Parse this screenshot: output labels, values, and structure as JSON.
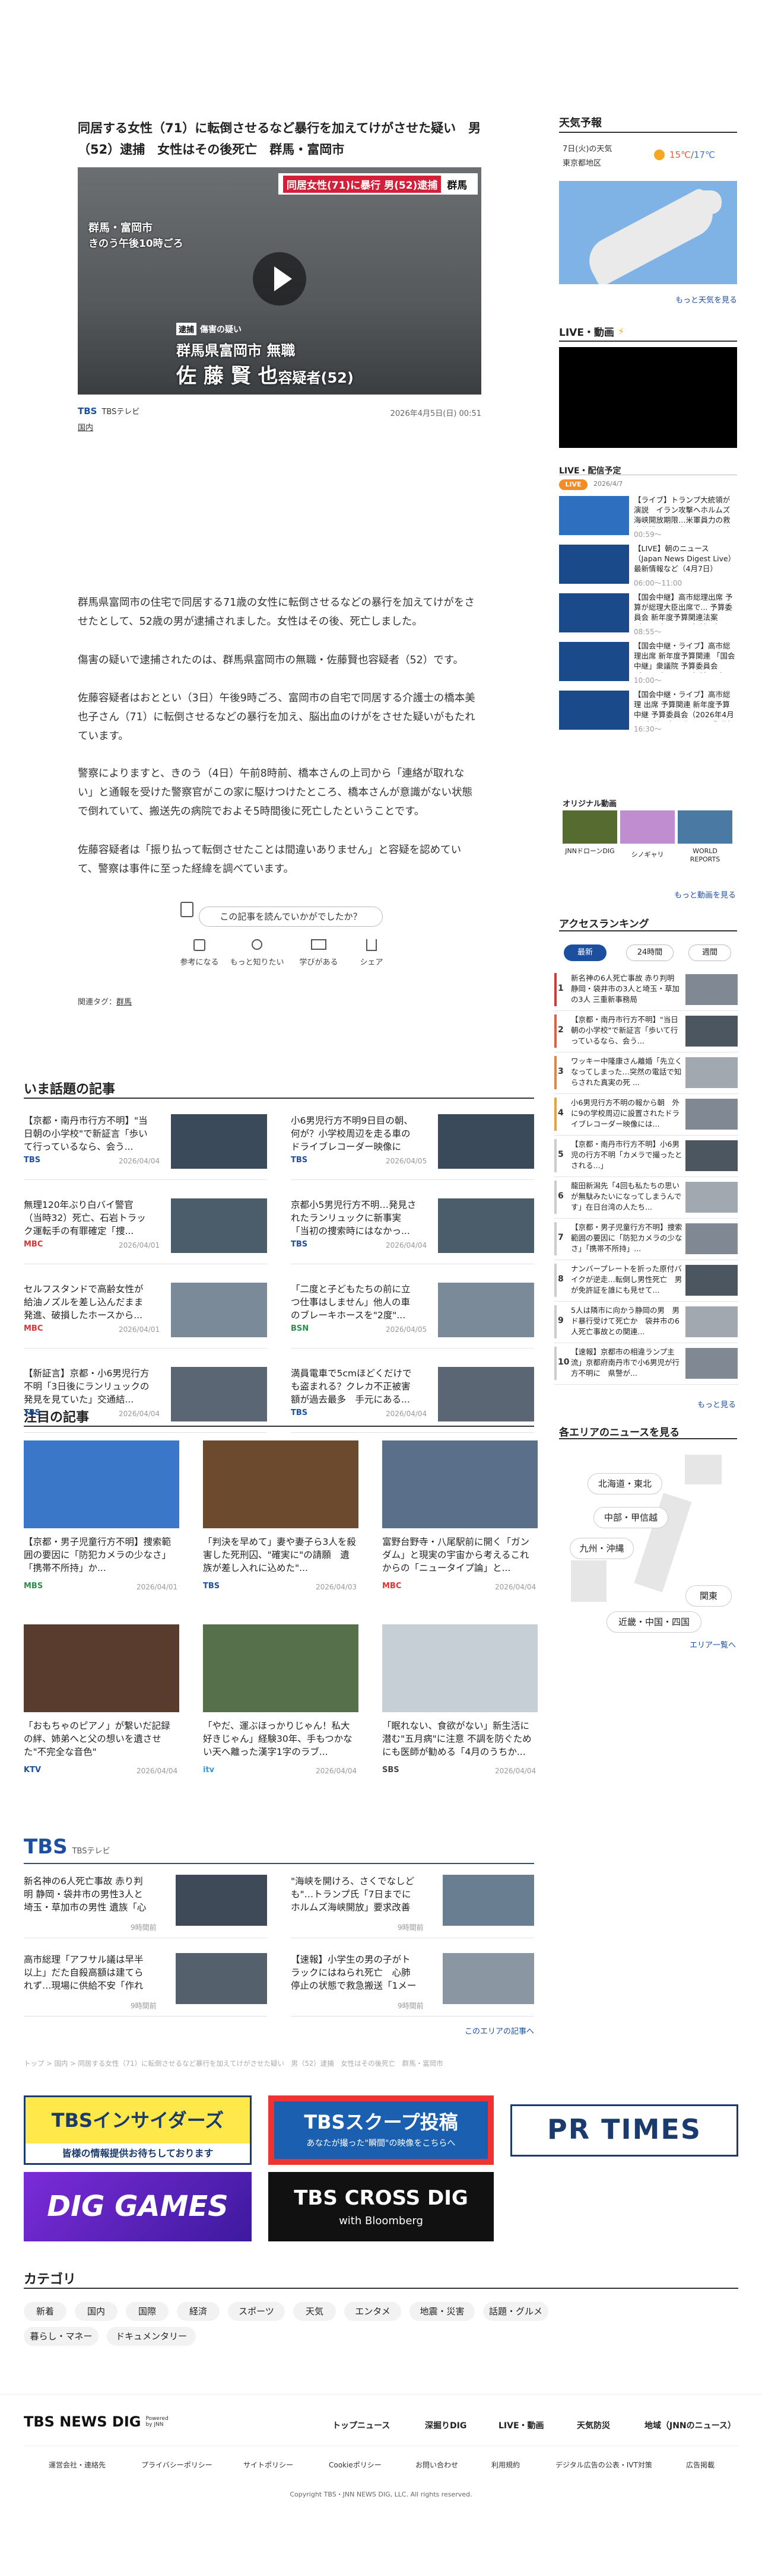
{
  "article": {
    "title": "同居する女性（71）に転倒させるなど暴行を加えてけがさせた疑い　男（52）逮捕　女性はその後死亡　群馬・富岡市",
    "hero_band": "同居女性(71)に暴行 男(52)逮捕",
    "hero_band_tail": "群馬",
    "hero_place": "群馬・富岡市",
    "hero_time": "きのう午後10時ごろ",
    "hero_tag": "逮捕",
    "hero_tag_label": "傷害の疑い",
    "hero_name_line1": "群馬県富岡市 無職",
    "hero_name_line2": "佐 藤 賢 也",
    "hero_name_suffix": "容疑者(52)",
    "source_logo": "TBS",
    "source": "TBSテレビ",
    "datetime": "2026年4月5日(日) 00:51",
    "category": "国内",
    "paragraphs": [
      "群馬県富岡市の住宅で同居する71歳の女性に転倒させるなどの暴行を加えてけがをさせたとして、52歳の男が逮捕されました。女性はその後、死亡しました。",
      "傷害の疑いで逮捕されたのは、群馬県富岡市の無職・佐藤賢也容疑者（52）です。",
      "佐藤容疑者はおととい（3日）午後9時ごろ、富岡市の自宅で同居する介護士の橋本美也子さん（71）に転倒させるなどの暴行を加え、脳出血のけがをさせた疑いがもたれています。",
      "警察によりますと、きのう（4日）午前8時前、橋本さんの上司から「連絡が取れない」と通報を受けた警察官がこの家に駆けつけたところ、橋本さんが意識がない状態で倒れていて、搬送先の病院でおよそ5時間後に死亡したということです。",
      "佐藤容疑者は「振り払って転倒させたことは間違いありません」と容疑を認めていて、警察は事件に至った経緯を調べています。"
    ],
    "feedback_question": "この記事を読んでいかがでしたか？",
    "feedback_options": [
      "参考になる",
      "もっと知りたい",
      "学びがある",
      "シェア"
    ],
    "related_tags_label": "関連タグ：",
    "related_tag": "群馬"
  },
  "weather": {
    "title": "天気予報",
    "day": "7日(火)の天気",
    "region": "東京都地区",
    "high": "15℃",
    "sep": "/",
    "low": "17℃",
    "more": "もっと天気を見る"
  },
  "live": {
    "title": "LIVE・動画",
    "schedule_title": "LIVE・配信予定",
    "badge": "LIVE",
    "date": "2026/4/7",
    "items": [
      {
        "text": "【ライブ】トランプ大統領が演説　イラン攻撃ヘホルムズ海峡開放期限…米軍員力の救出作戦などを言及か（日本時間4月7日午前1時〜LIVE配信）",
        "time": "00:59〜"
      },
      {
        "text": "【LIVE】朝のニュース（Japan News Digest Live）最新情報など（4月7日）",
        "time": "06:00〜11:00"
      },
      {
        "text": "【国会中継】高市総理出席 予算が総理大臣出席で... 予算委員会 新年度予算関連法案（2026年4月7日午前8時55分〜LIVE配信）",
        "time": "08:55〜"
      },
      {
        "text": "【国会中継・ライブ】高市総理出席 新年度予算関連 「国会中継」衆議院 予算委員会（2026年4月7日午前10時〜LIVE配信）",
        "time": "10:00〜"
      },
      {
        "text": "【国会中継・ライブ】高市総理 出席 予算関連 新年度予算 中継 予算委員会（2026年4月7日午後4時30分〜LIVE配信）",
        "time": "16:30〜"
      }
    ],
    "original_title": "オリジナル動画",
    "originals": [
      "JNNドローンDIG",
      "シノギャリ",
      "WORLD REPORTS"
    ],
    "more": "もっと動画を見る"
  },
  "ranking": {
    "title": "アクセスランキング",
    "tabs": [
      "最新",
      "24時間",
      "週間"
    ],
    "items": [
      "新名神の6人死亡事故 赤り判明 静岡・袋井市の3人と埼玉・草加の3人 三重新事務局",
      "【京都・南丹市行方不明】\"当日朝の小学校\"で新証言「歩いて行っているなら、会う...",
      "ワッキー中隆康さん離婚「先立くなってしまった…突然の電話で知らされた真実の死 ...",
      "小6男児行方不明の報から朝　外に9の学校周辺に設置されたドライブレコーダー映像には...",
      "【京都・南丹市行方不明】小6男児の行方不明「カメラで撮ったとされる...」",
      "龍田新潟先「4回も私たちの思いが無駄みたいになってしまうんです」在日台湾の人たち...",
      "【京都・男子児童行方不明】捜索範囲の要因に「防犯カメラの少なさ」「携帯不所持」...",
      "ナンバープレートを折った原付バイクが逆走…転倒し男性死亡　男が免許証を誰にも見せて...",
      "5人は隣市に向かう静岡の男　男ド暴行受けて死亡か　袋井市の6人死亡事故との関連...",
      "【速報】京都市の相違ランプ主流」京都府南丹市で小6男児が行方不明に　県警が..."
    ],
    "more": "もっと見る"
  },
  "regions": {
    "title": "各エリアのニュースを見る",
    "labels": [
      "北海道・東北",
      "中部・甲信越",
      "九州・沖縄",
      "関東",
      "近畿・中国・四国"
    ],
    "more": "エリア一覧へ"
  },
  "trending": {
    "title": "いま話題の記事",
    "items": [
      {
        "title": "【京都・南丹市行方不明】\"当日朝の小学校\"で新証言「歩いて行っているなら、会う...",
        "src": "TBS",
        "date": "2026/04/04"
      },
      {
        "title": "小6男児行方不明9日目の朝、何が？小学校周辺を走る車のドライブレコーダー映像には...",
        "src": "TBS",
        "date": "2026/04/05"
      },
      {
        "title": "無理120年ぶり白バイ警官（当時32）死亡、石岩トラック運転手の有罪確定「捜...",
        "src": "MBC",
        "date": "2026/04/01"
      },
      {
        "title": "京都小5男児行方不明…発見されたランリュックに新事実「当初の捜索時にはなかっ...",
        "src": "TBS",
        "date": "2026/04/04"
      },
      {
        "title": "セルフスタンドで高齢女性が給油ノズルを差し込んだまま発進、破損したホースから...",
        "src": "MBC",
        "date": "2026/04/01"
      },
      {
        "title": "「二度と子どもたちの前に立つ仕事はしません」他人の車のブレーキホースを\"2度\"...",
        "src": "BSN",
        "date": "2026/04/05"
      },
      {
        "title": "【新証言】京都・小6男児行方不明「3日後にランリュックの発見を見ていた」交通結...",
        "src": "TBS",
        "date": "2026/04/04"
      },
      {
        "title": "満員電車で5cmほどくだけでも盗まれる？クレカ不正被害額が過去最多　手元にある...",
        "src": "TBS",
        "date": "2026/04/04"
      }
    ]
  },
  "featured": {
    "title": "注目の記事",
    "items": [
      {
        "title": "【京都・男子児童行方不明】捜索範囲の要因に「防犯カメラの少なさ」「携帯不所持」か...",
        "src": "MBS",
        "date": "2026/04/01"
      },
      {
        "title": "「判決を早めて」妻や妻子ら3人を殺害した死刑囚、\"確実に\"の請願　遺族が差し入れに込めた\"...",
        "src": "TBS",
        "date": "2026/04/03"
      },
      {
        "title": "富野台野寺・八尾駅前に開く「ガンダム」と現実の宇宙から考えるこれからの「ニュータイプ論」と...",
        "src": "MBC",
        "date": "2026/04/04"
      },
      {
        "title": "「おもちゃのピアノ」が繋いだ記録の絆、姉弟へと父の想いを遺させた\"不完全な音色\"",
        "src": "KTV",
        "date": "2026/04/04"
      },
      {
        "title": "「やだ、運ぶほっかりじゃん！私大好きじゃん」経験30年、手もつかない天へ離った漢字1字のラブ...",
        "src": "itv",
        "date": "2026/04/04"
      },
      {
        "title": "「眠れない、食欲がない」新生活に潜む\"五月病\"に注意 不調を防ぐためにも医師が勧める「4月のうちか...",
        "src": "SBS",
        "date": "2026/04/04"
      }
    ]
  },
  "tbs_section": {
    "logo": "TBS",
    "sub": "TBSテレビ",
    "items": [
      {
        "title": "新名神の6人死亡事故 赤り判明 静岡・袋井市の男性3人と埼玉・草加市の男性 遺族「心の整理が...",
        "date": "9時間前"
      },
      {
        "title": "\"海峡を開けろ、さくでなしども\"…トランプ氏「7日までにホルムズ海峡開放」要求改善の...",
        "date": "9時間前"
      },
      {
        "title": "高市総理「アフサル議は早半以上」だた自殺高額は建てられず…現場に供給不安「作れば...",
        "date": "9時間前"
      },
      {
        "title": "【速報】小学生の男の子がトラックにはねられ死亡　心肺停止の状態で救急搬送「1メート...",
        "date": "9時間前"
      }
    ],
    "more": "このエリアの記事へ"
  },
  "breadcrumb": "トップ > 国内 > 同居する女性（71）に転倒させるなど暴行を加えてけがさせた疑い　男（52）逮捕　女性はその後死亡　群馬・富岡市",
  "banners": {
    "insiders": "TBSインサイダーズ",
    "insiders_sub": "皆様の情報提供お待ちしております",
    "scoop": "TBSスクープ投稿",
    "scoop_sub": "あなたが撮った\"瞬間\"の映像をこちらへ",
    "prtimes": "PR TIMES",
    "diggames": "DIG GAMES",
    "crossdig": "TBS CROSS DIG",
    "crossdig_sub": "with Bloomberg"
  },
  "categories": {
    "title": "カテゴリ",
    "items": [
      "新着",
      "国内",
      "国際",
      "経済",
      "スポーツ",
      "天気",
      "エンタメ",
      "地震・災害",
      "話題・グルメ",
      "暮らし・マネー",
      "ドキュメンタリー"
    ]
  },
  "footer": {
    "logo": "TBS NEWS DIG",
    "logo_by": "Powered by JNN",
    "nav": [
      "トップニュース",
      "深掘りDIG",
      "LIVE・動画",
      "天気防災",
      "地域（JNNのニュース）"
    ],
    "links": [
      "運営会社・連絡先",
      "プライバシーポリシー",
      "サイトポリシー",
      "Cookieポリシー",
      "お問い合わせ",
      "利用規約",
      "デジタル広告の公表・IVT対策",
      "広告掲載"
    ],
    "copyright": "Copyright TBS・JNN NEWS DIG, LLC. All rights reserved."
  }
}
